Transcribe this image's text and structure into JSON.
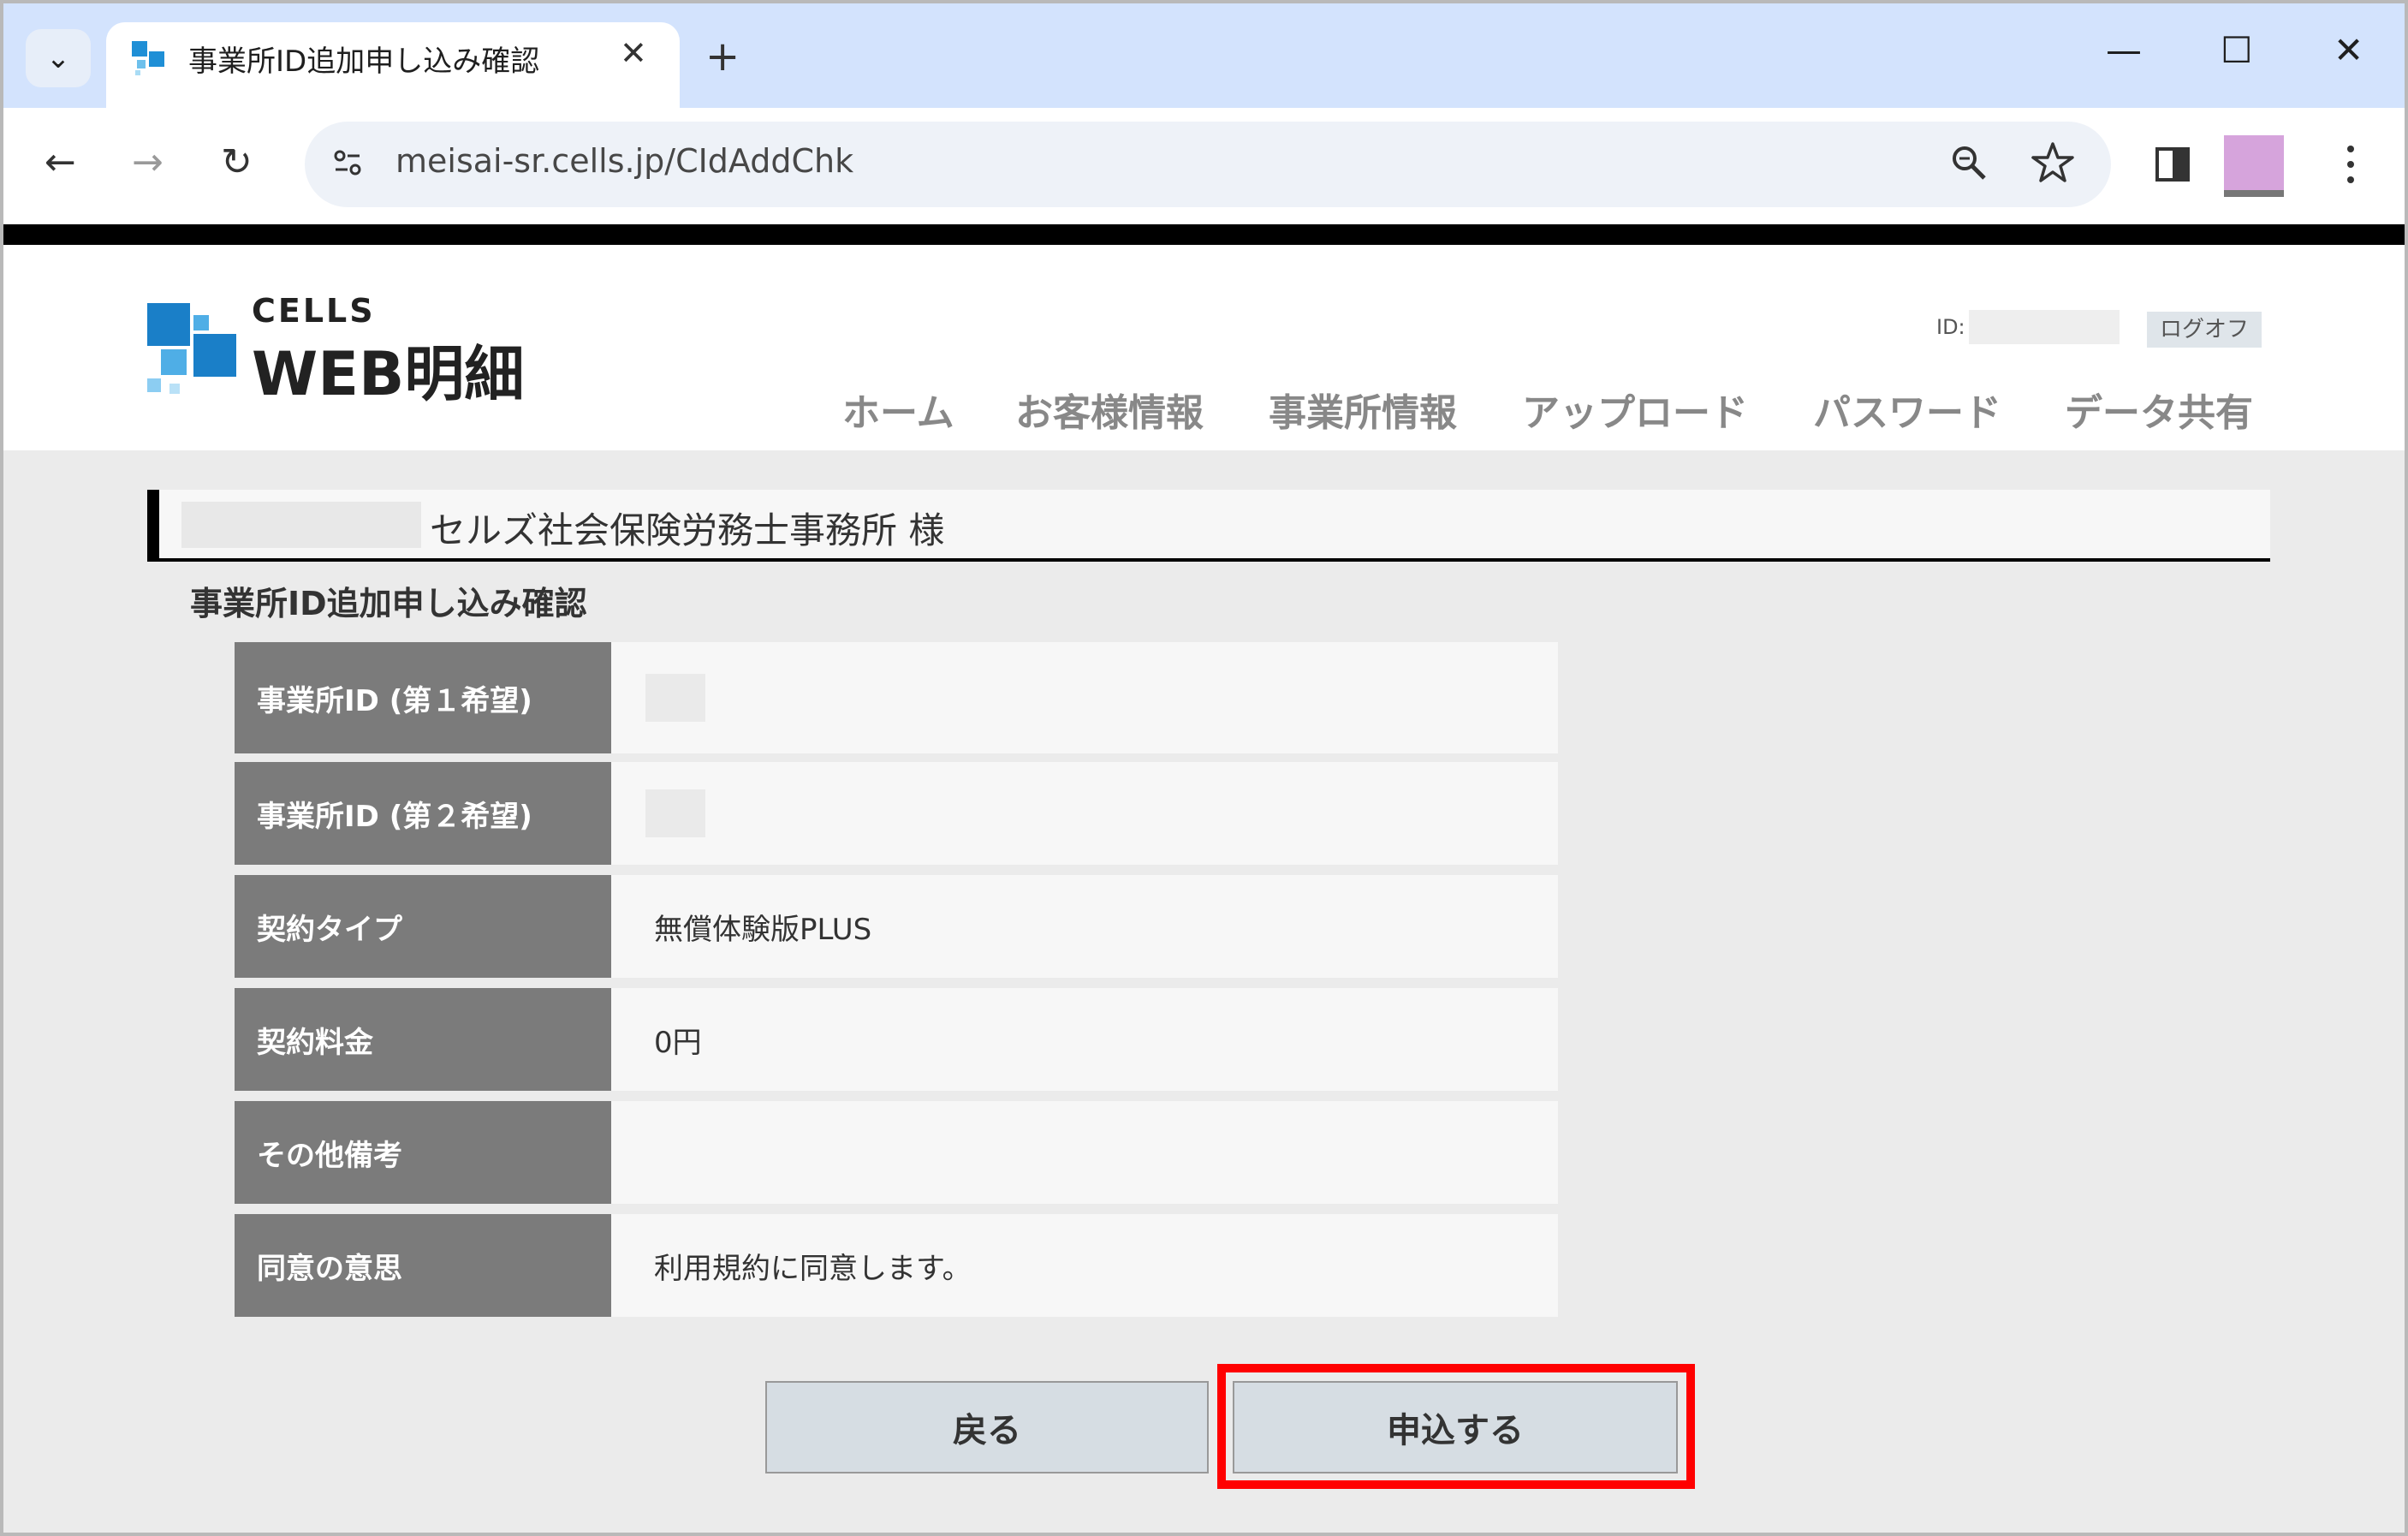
{
  "browser": {
    "tab_title": "事業所ID追加申し込み確認",
    "tab_close": "✕",
    "new_tab": "+",
    "tab_menu": "⌄",
    "win_min": "—",
    "win_max": "☐",
    "win_close": "✕",
    "url": "meisai-sr.cells.jp/CIdAddChk",
    "back": "←",
    "forward": "→",
    "reload": "↻"
  },
  "header": {
    "logo_small": "CELLS",
    "logo_main": "WEB明細",
    "id_label": "ID:",
    "logoff": "ログオフ",
    "nav": [
      "ホーム",
      "お客様情報",
      "事業所情報",
      "アップロード",
      "パスワード",
      "データ共有"
    ]
  },
  "page": {
    "customer_name": "セルズ社会保険労務士事務所 様",
    "section_title": "事業所ID追加申し込み確認",
    "rows": [
      {
        "label": "事業所ID (第１希望)",
        "value": ""
      },
      {
        "label": "事業所ID (第２希望)",
        "value": ""
      },
      {
        "label": "契約タイプ",
        "value": "無償体験版PLUS"
      },
      {
        "label": "契約料金",
        "value": "0円"
      },
      {
        "label": "その他備考",
        "value": ""
      },
      {
        "label": "同意の意思",
        "value": "利用規約に同意します。"
      }
    ],
    "back_button": "戻る",
    "submit_button": "申込する"
  },
  "colors": {
    "accent_highlight": "#ff0000",
    "table_header": "#7b7b7b",
    "browser_tabbar": "#d3e3fd"
  }
}
